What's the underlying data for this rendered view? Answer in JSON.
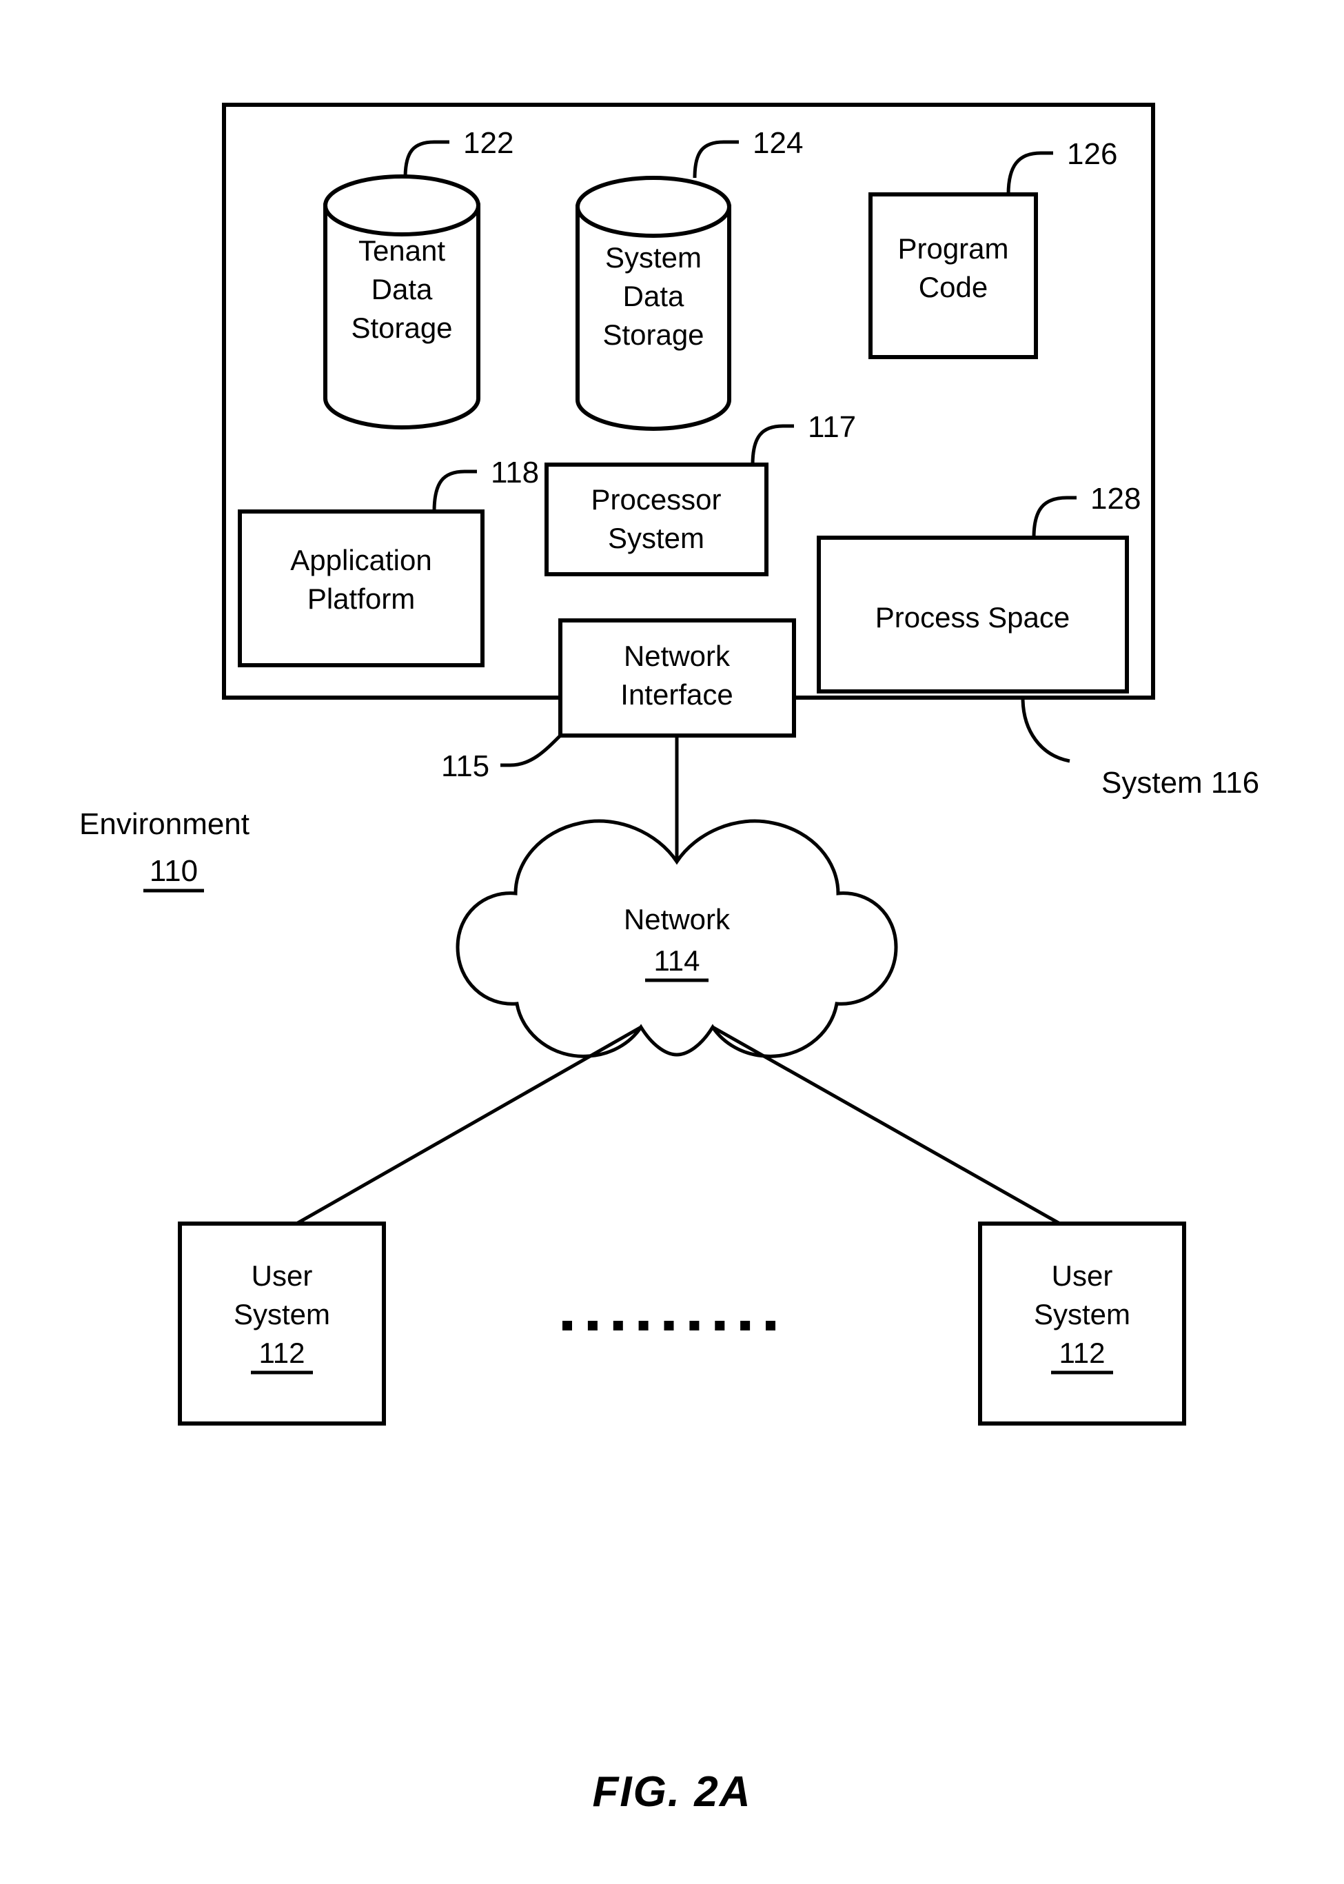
{
  "figure": {
    "caption": "FIG. 2A",
    "environment_label": "Environment",
    "environment_number": "110",
    "system_label": "System 116"
  },
  "nodes": {
    "tenant_data_storage": {
      "line1": "Tenant",
      "line2": "Data",
      "line3": "Storage",
      "ref": "122",
      "shape": "cylinder"
    },
    "system_data_storage": {
      "line1": "System",
      "line2": "Data",
      "line3": "Storage",
      "ref": "124",
      "shape": "cylinder"
    },
    "program_code": {
      "line1": "Program",
      "line2": "Code",
      "ref": "126",
      "shape": "rect"
    },
    "application_platform": {
      "line1": "Application",
      "line2": "Platform",
      "ref": "118",
      "shape": "rect"
    },
    "processor_system": {
      "line1": "Processor",
      "line2": "System",
      "ref": "117",
      "shape": "rect"
    },
    "process_space": {
      "line1": "Process Space",
      "ref": "128",
      "shape": "rect"
    },
    "network_interface": {
      "line1": "Network",
      "line2": "Interface",
      "ref": "115",
      "shape": "rect"
    },
    "network_cloud": {
      "line1": "Network",
      "ref": "114",
      "shape": "cloud"
    },
    "user_system_left": {
      "line1": "User",
      "line2": "System",
      "ref": "112",
      "shape": "rect"
    },
    "user_system_right": {
      "line1": "User",
      "line2": "System",
      "ref": "112",
      "shape": "rect"
    }
  },
  "ellipsis": {
    "dot_count": 9,
    "label": "........."
  },
  "colors": {
    "stroke": "#000000",
    "fill": "#ffffff",
    "background": "#ffffff"
  }
}
